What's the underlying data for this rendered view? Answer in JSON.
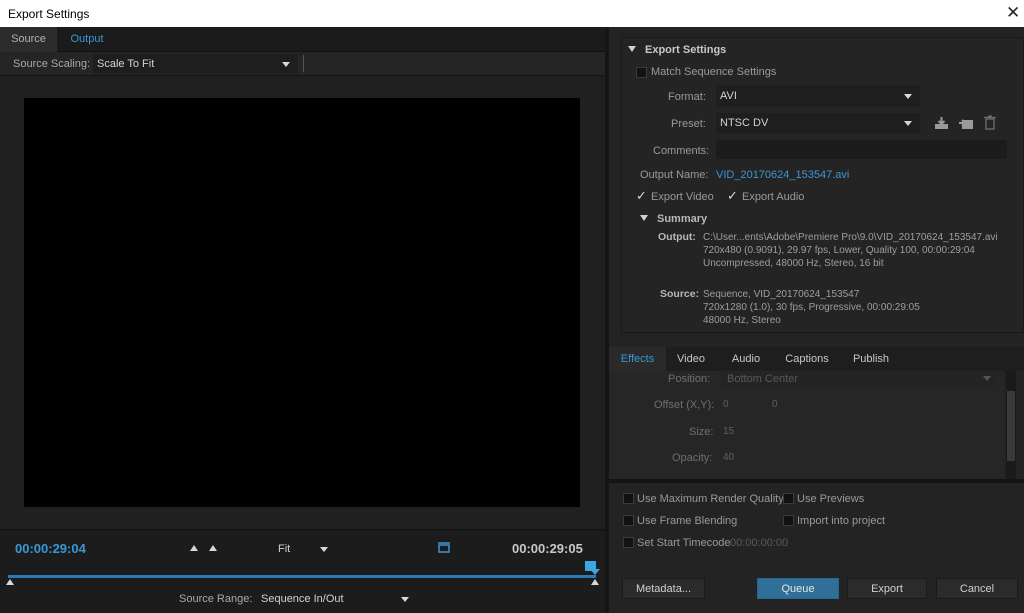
{
  "window": {
    "title": "Export Settings",
    "close_glyph": "✕"
  },
  "left": {
    "tabs": [
      "Source",
      "Output"
    ],
    "source_scaling_label": "Source Scaling:",
    "source_scaling_value": "Scale To Fit",
    "timecode_in": "00:00:29:04",
    "timecode_out": "00:00:29:05",
    "zoom_value": "Fit",
    "source_range_label": "Source Range:",
    "source_range_value": "Sequence In/Out"
  },
  "export_settings": {
    "header": "Export Settings",
    "match_sequence_label": "Match Sequence Settings",
    "format_label": "Format:",
    "format_value": "AVI",
    "preset_label": "Preset:",
    "preset_value": "NTSC DV",
    "comments_label": "Comments:",
    "output_name_label": "Output Name:",
    "output_name_value": "VID_20170624_153547.avi",
    "export_video_label": "Export Video",
    "export_audio_label": "Export Audio",
    "summary_header": "Summary",
    "summary_output_label": "Output:",
    "summary_output_lines": [
      "C:\\User...ents\\Adobe\\Premiere Pro\\9.0\\VID_20170624_153547.avi",
      "720x480 (0.9091), 29.97 fps, Lower, Quality 100, 00:00:29:04",
      "Uncompressed, 48000 Hz, Stereo, 16 bit"
    ],
    "summary_source_label": "Source:",
    "summary_source_lines": [
      "Sequence, VID_20170624_153547",
      "720x1280 (1.0), 30 fps, Progressive, 00:00:29:05",
      "48000 Hz, Stereo"
    ]
  },
  "effects": {
    "tabs": [
      "Effects",
      "Video",
      "Audio",
      "Captions",
      "Publish"
    ],
    "position_label": "Position:",
    "position_value": "Bottom Center",
    "offset_label": "Offset (X,Y):",
    "offset_x": "0",
    "offset_y": "0",
    "size_label": "Size:",
    "size_value": "15",
    "opacity_label": "Opacity:",
    "opacity_value": "40"
  },
  "options": {
    "use_max_render_quality": "Use Maximum Render Quality",
    "use_previews": "Use Previews",
    "use_frame_blending": "Use Frame Blending",
    "import_into_project": "Import into project",
    "set_start_timecode": "Set Start Timecode",
    "start_timecode_value": "00:00:00:00"
  },
  "buttons": {
    "metadata": "Metadata...",
    "queue": "Queue",
    "export": "Export",
    "cancel": "Cancel"
  },
  "colors": {
    "accent": "#3a97d6",
    "queue_button": "#2f6f98"
  }
}
